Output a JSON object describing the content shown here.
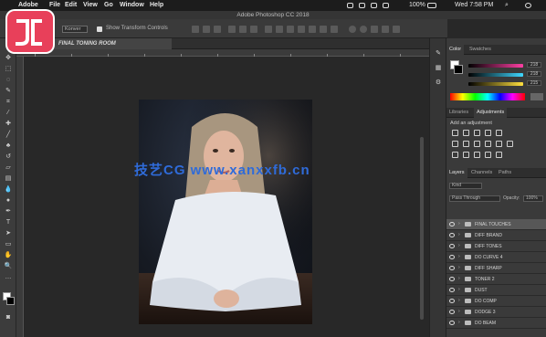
{
  "menubar": {
    "app_name": "Adobe",
    "items": [
      "File",
      "Edit",
      "View",
      "Go",
      "Window",
      "Help"
    ],
    "battery": "100%",
    "clock": "Wed 7:58 PM"
  },
  "window": {
    "title": "Adobe Photoshop CC 2018"
  },
  "options_bar": {
    "mode_label": "Konver",
    "checkbox_label": "Show Transform Controls"
  },
  "document": {
    "tab_label": "FINAL TONING ROOM"
  },
  "watermark": {
    "text": "技艺CG www.xanxxfb.cn"
  },
  "color_panel": {
    "tabs": [
      "Color",
      "Swatches"
    ],
    "values": [
      "218",
      "218",
      "215"
    ],
    "colors": {
      "r": "#ff3fa4",
      "g": "#3fd7ff",
      "b": "#ffe03f"
    }
  },
  "adjustments_panel": {
    "tabs": [
      "Libraries",
      "Adjustments"
    ],
    "title": "Add an adjustment"
  },
  "layers_panel": {
    "tabs": [
      "Layers",
      "Channels",
      "Paths"
    ],
    "kind_filter": "Kind",
    "blend_mode": "Pass Through",
    "opacity_label": "Opacity:",
    "opacity_value": "100%",
    "layers": [
      "FINAL TOUCHES",
      "DIFF BRAND",
      "DIFF TONES",
      "DO CURVE 4",
      "DIFF SHARP",
      "TONER 2",
      "DUST",
      "DO COMP",
      "DODGE 3",
      "DO BEAM"
    ]
  }
}
